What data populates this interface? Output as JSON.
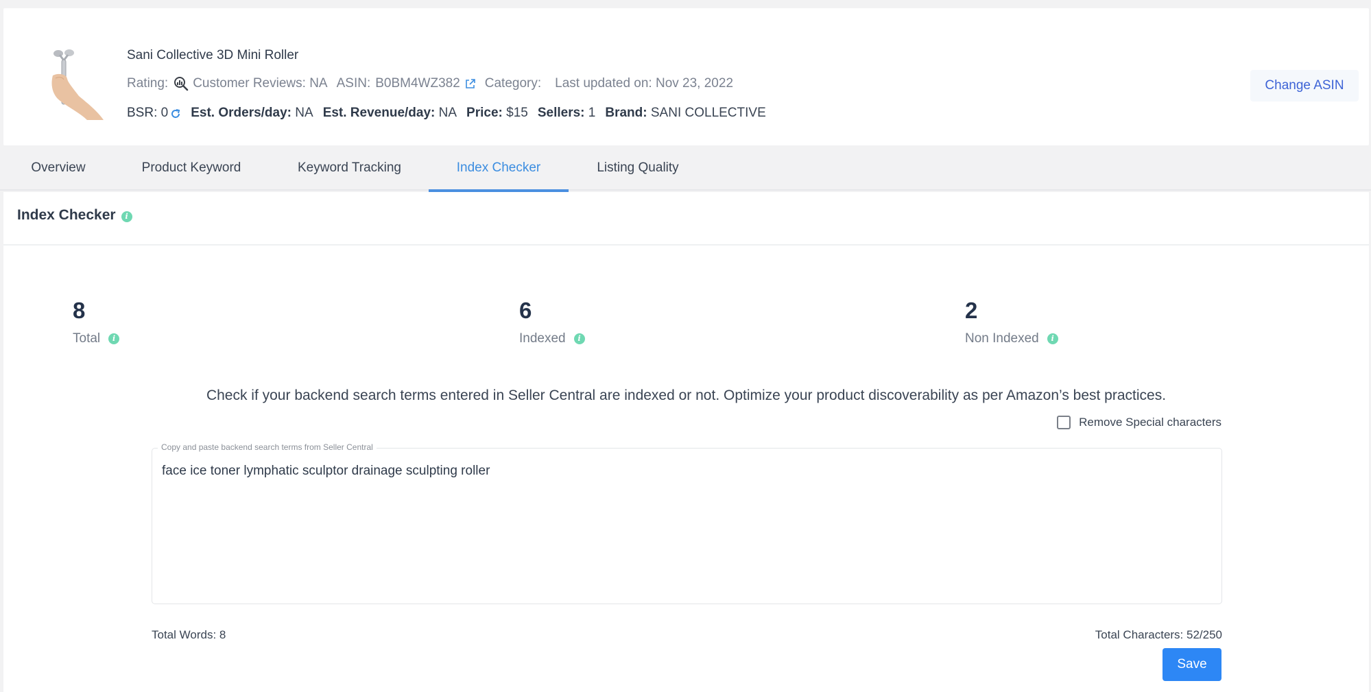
{
  "product": {
    "title": "Sani Collective 3D Mini Roller",
    "image_alt": "face roller held in hand",
    "rating_label": "Rating:",
    "customer_reviews": "Customer Reviews: NA",
    "asin_label": "ASIN:",
    "asin": "B0BM4WZ382",
    "category_label": "Category:",
    "category": "",
    "last_updated": "Last updated on: Nov 23, 2022",
    "stats": {
      "bsr_label": "BSR:",
      "bsr": "0",
      "orders_label": "Est. Orders/day:",
      "orders": "NA",
      "revenue_label": "Est. Revenue/day:",
      "revenue": "NA",
      "price_label": "Price:",
      "price": "$15",
      "sellers_label": "Sellers:",
      "sellers": "1",
      "brand_label": "Brand:",
      "brand": "SANI COLLECTIVE"
    },
    "change_asin_label": "Change ASIN"
  },
  "tabs": [
    {
      "label": "Overview",
      "active": false
    },
    {
      "label": "Product Keyword",
      "active": false
    },
    {
      "label": "Keyword Tracking",
      "active": false
    },
    {
      "label": "Index Checker",
      "active": true
    },
    {
      "label": "Listing Quality",
      "active": false
    }
  ],
  "index_checker": {
    "title": "Index Checker",
    "summary": [
      {
        "value": "8",
        "label": "Total"
      },
      {
        "value": "6",
        "label": "Indexed"
      },
      {
        "value": "2",
        "label": "Non Indexed"
      }
    ],
    "description": "Check if your backend search terms entered in Seller Central are indexed or not. Optimize your product discoverability as per Amazon’s best practices.",
    "remove_special_label": "Remove Special characters",
    "remove_special_checked": false,
    "terms_field_label": "Copy and paste backend search terms from Seller Central",
    "terms_value": "face ice toner lymphatic sculptor drainage sculpting roller",
    "total_words": "Total Words: 8",
    "total_characters": "Total Characters: 52/250",
    "save_label": "Save"
  },
  "colors": {
    "accent_blue": "#3b8de0",
    "save_blue": "#2d87f5",
    "info_green": "#6fd8b2",
    "change_asin_text": "#3d63d6"
  }
}
